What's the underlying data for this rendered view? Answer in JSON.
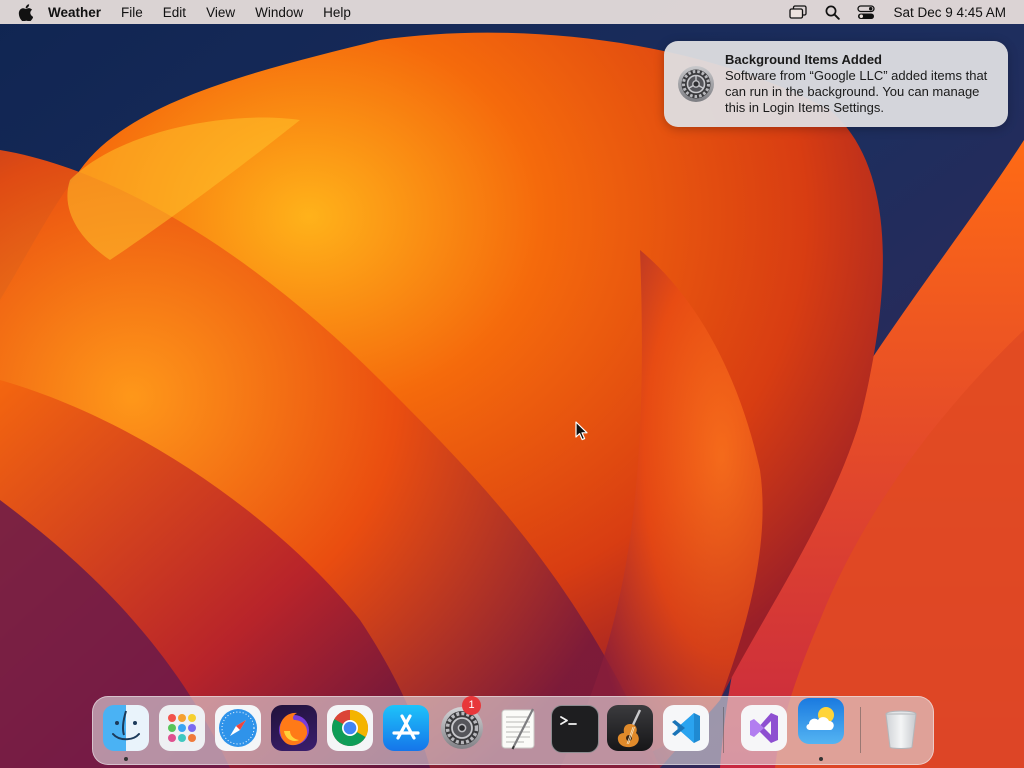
{
  "menubar": {
    "app_name": "Weather",
    "items": [
      "File",
      "Edit",
      "View",
      "Window",
      "Help"
    ],
    "clock": "Sat Dec 9  4:45 AM",
    "status_icons": [
      "screen-mirroring-icon",
      "spotlight-search-icon",
      "control-center-icon"
    ]
  },
  "notification": {
    "title": "Background Items Added",
    "body": "Software from “Google LLC” added items that can run in the background. You can manage this in Login Items Settings.",
    "icon": "system-settings-icon"
  },
  "dock": {
    "apps": [
      "finder-icon",
      "launchpad-icon",
      "safari-icon",
      "firefox-icon",
      "chrome-icon",
      "app-store-icon",
      "system-settings-icon",
      "textedit-icon",
      "terminal-icon",
      "garageband-icon",
      "vscode-icon",
      "visual-studio-icon",
      "weather-icon",
      "trash-icon"
    ],
    "settings_badge": "1",
    "running": [
      "finder",
      "weather"
    ]
  },
  "colors": {
    "wallpaper_orange": "#f26a10",
    "wallpaper_navy": "#13244c",
    "badge_red": "#e8373a"
  }
}
